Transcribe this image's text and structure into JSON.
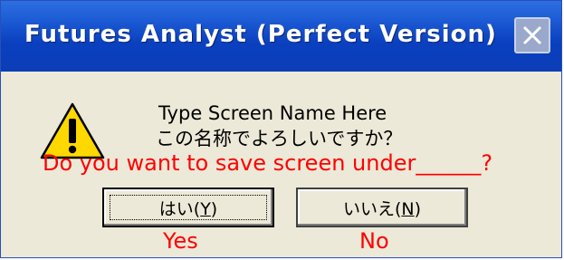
{
  "window": {
    "title": "Futures Analyst (Perfect Version)",
    "close_icon": "close-icon"
  },
  "dialog": {
    "icon": "warning-icon",
    "message_line1": "Type Screen Name Here",
    "message_line2": "この名称でよろしいですか？",
    "translation_overlay": "Do you want to save screen under______?",
    "buttons": {
      "yes": {
        "prefix": "はい(",
        "mnemonic": "Y",
        "suffix": ")"
      },
      "no": {
        "prefix": "いいえ(",
        "mnemonic": "N",
        "suffix": ")"
      }
    },
    "yes_overlay": "Yes",
    "no_overlay": "No"
  },
  "colors": {
    "title_bar": "#0b3eb6",
    "dialog_background": "#ece9d8",
    "annotation": "#ff0000",
    "warning_fill": "#ffd800"
  }
}
